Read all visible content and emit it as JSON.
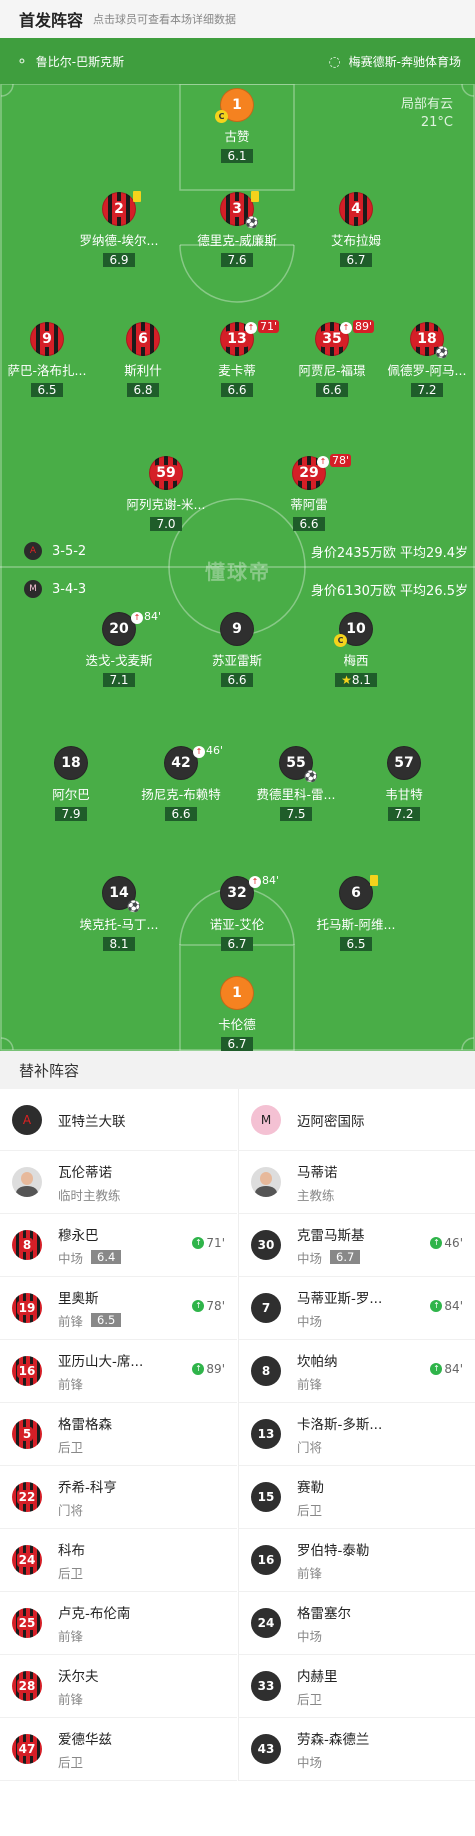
{
  "header": {
    "title": "首发阵容",
    "subtitle": "点击球员可查看本场详细数据"
  },
  "pitch": {
    "referee": "鲁比尔-巴斯克斯",
    "stadium": "梅赛德斯-奔驰体育场",
    "weather": "局部有云",
    "temperature": "21°C",
    "watermark": "懂球帝",
    "home_formation": "3-5-2",
    "home_value": "身价2435万欧 平均29.4岁",
    "away_formation": "3-4-3",
    "away_value": "身价6130万欧 平均26.5岁"
  },
  "home_players": [
    {
      "num": "1",
      "name": "古赞",
      "rating": "6.1"
    },
    {
      "num": "2",
      "name": "罗纳德-埃尔...",
      "rating": "6.9"
    },
    {
      "num": "3",
      "name": "德里克-威廉斯",
      "rating": "7.6"
    },
    {
      "num": "4",
      "name": "艾布拉姆",
      "rating": "6.7"
    },
    {
      "num": "9",
      "name": "萨巴-洛布扎...",
      "rating": "6.5"
    },
    {
      "num": "6",
      "name": "斯利什",
      "rating": "6.8"
    },
    {
      "num": "13",
      "name": "麦卡蒂",
      "rating": "6.6",
      "sub": "71'"
    },
    {
      "num": "35",
      "name": "阿贾尼-福璟",
      "rating": "6.6",
      "sub": "89'"
    },
    {
      "num": "18",
      "name": "佩德罗-阿马...",
      "rating": "7.2"
    },
    {
      "num": "59",
      "name": "阿列克谢-米...",
      "rating": "7.0"
    },
    {
      "num": "29",
      "name": "蒂阿雷",
      "rating": "6.6",
      "sub": "78'"
    }
  ],
  "away_players": [
    {
      "num": "20",
      "name": "迭戈-戈麦斯",
      "rating": "7.1",
      "sub": "84'"
    },
    {
      "num": "9",
      "name": "苏亚雷斯",
      "rating": "6.6"
    },
    {
      "num": "10",
      "name": "梅西",
      "rating": "8.1"
    },
    {
      "num": "18",
      "name": "阿尔巴",
      "rating": "7.9"
    },
    {
      "num": "42",
      "name": "扬尼克-布赖特",
      "rating": "6.6",
      "sub": "46'"
    },
    {
      "num": "55",
      "name": "费德里科-雷...",
      "rating": "7.5"
    },
    {
      "num": "57",
      "name": "韦甘特",
      "rating": "7.2"
    },
    {
      "num": "14",
      "name": "埃克托-马丁...",
      "rating": "8.1"
    },
    {
      "num": "32",
      "name": "诺亚-艾伦",
      "rating": "6.7",
      "sub": "84'"
    },
    {
      "num": "6",
      "name": "托马斯-阿维...",
      "rating": "6.5"
    },
    {
      "num": "1",
      "name": "卡伦德",
      "rating": "6.7"
    }
  ],
  "bench": {
    "title": "替补阵容",
    "home_team": "亚特兰大联",
    "away_team": "迈阿密国际",
    "home_coach": {
      "name": "瓦伦蒂诺",
      "role": "临时主教练"
    },
    "away_coach": {
      "name": "马蒂诺",
      "role": "主教练"
    },
    "home_subs": [
      {
        "num": "8",
        "name": "穆永巴",
        "pos": "中场",
        "rating": "6.4",
        "time": "71'"
      },
      {
        "num": "19",
        "name": "里奥斯",
        "pos": "前锋",
        "rating": "6.5",
        "time": "78'"
      },
      {
        "num": "16",
        "name": "亚历山大-席...",
        "pos": "前锋",
        "time": "89'"
      },
      {
        "num": "5",
        "name": "格雷格森",
        "pos": "后卫"
      },
      {
        "num": "22",
        "name": "乔希-科亨",
        "pos": "门将"
      },
      {
        "num": "24",
        "name": "科布",
        "pos": "后卫"
      },
      {
        "num": "25",
        "name": "卢克-布伦南",
        "pos": "前锋"
      },
      {
        "num": "28",
        "name": "沃尔夫",
        "pos": "前锋"
      },
      {
        "num": "47",
        "name": "爱德华兹",
        "pos": "后卫"
      }
    ],
    "away_subs": [
      {
        "num": "30",
        "name": "克雷马斯基",
        "pos": "中场",
        "rating": "6.7",
        "time": "46'"
      },
      {
        "num": "7",
        "name": "马蒂亚斯-罗...",
        "pos": "中场",
        "time": "84'"
      },
      {
        "num": "8",
        "name": "坎帕纳",
        "pos": "前锋",
        "time": "84'"
      },
      {
        "num": "13",
        "name": "卡洛斯-多斯...",
        "pos": "门将"
      },
      {
        "num": "15",
        "name": "赛勒",
        "pos": "后卫"
      },
      {
        "num": "16",
        "name": "罗伯特-泰勒",
        "pos": "前锋"
      },
      {
        "num": "24",
        "name": "格雷塞尔",
        "pos": "中场"
      },
      {
        "num": "33",
        "name": "内赫里",
        "pos": "后卫"
      },
      {
        "num": "43",
        "name": "劳森-森德兰",
        "pos": "中场"
      }
    ]
  }
}
